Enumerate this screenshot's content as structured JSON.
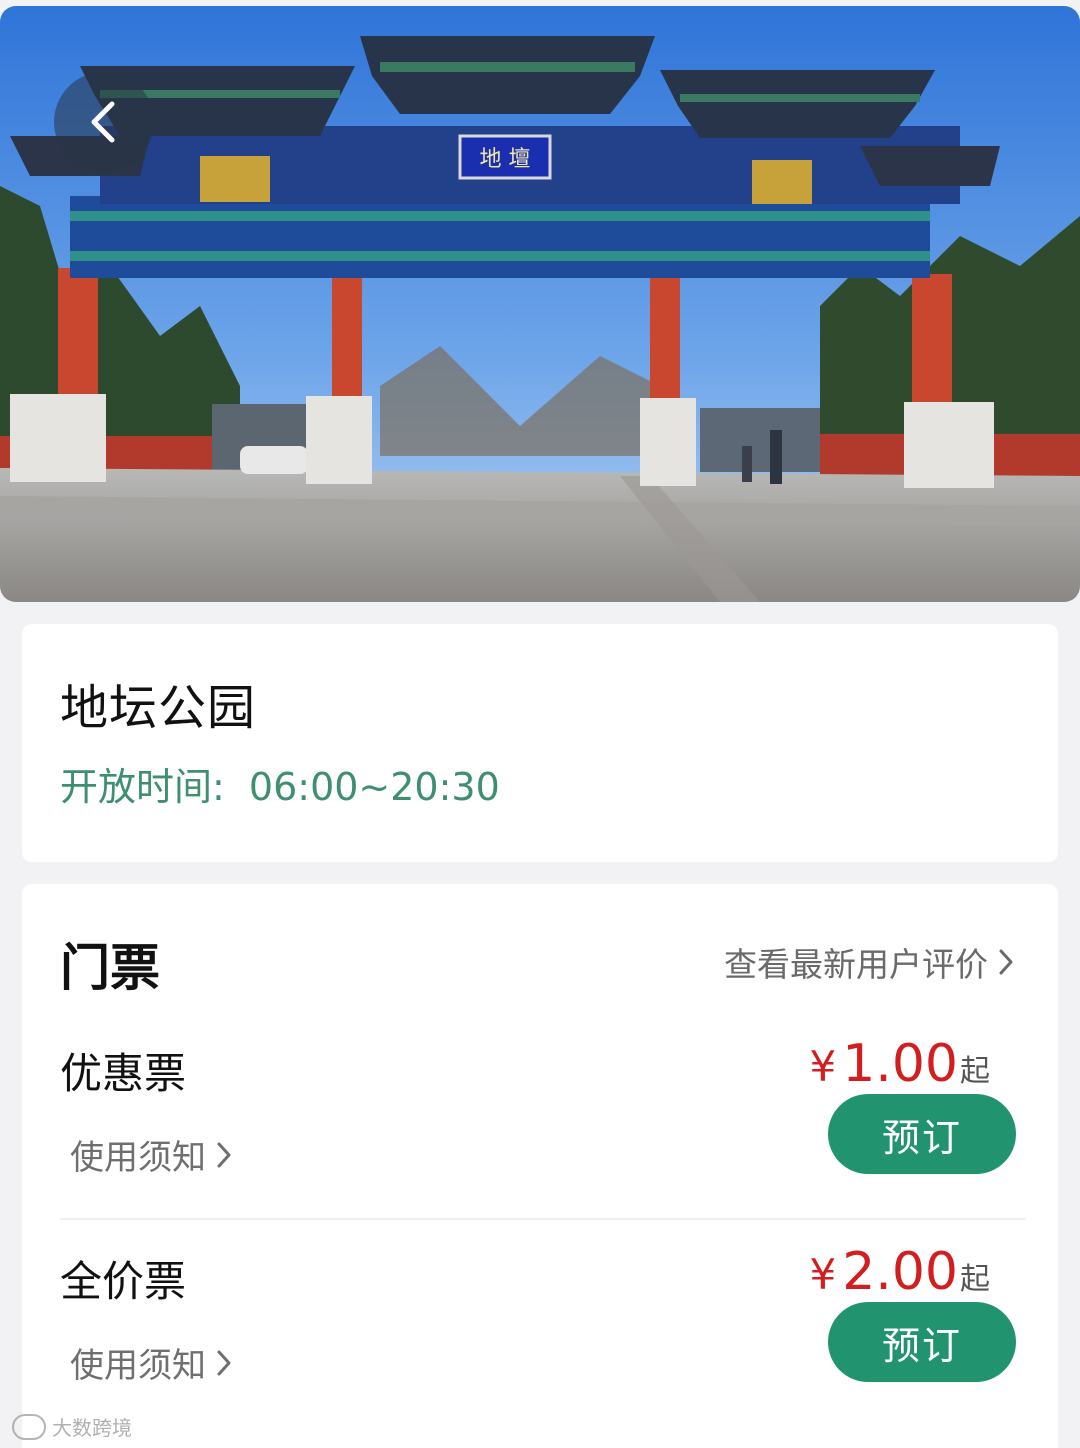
{
  "hero": {
    "back_icon": "chevron-left-icon",
    "signboard_text": "地 壇"
  },
  "park": {
    "name": "地坛公园",
    "hours_label": "开放时间:",
    "hours_value": "06:00~20:30"
  },
  "tickets_section": {
    "title": "门票",
    "reviews_link": "查看最新用户评价",
    "reviews_icon": "chevron-right-icon",
    "items": [
      {
        "name": "优惠票",
        "notice": "使用须知",
        "currency": "¥",
        "price": "1.00",
        "suffix": "起",
        "button": "预订"
      },
      {
        "name": "全价票",
        "notice": "使用须知",
        "currency": "¥",
        "price": "2.00",
        "suffix": "起",
        "button": "预订"
      }
    ]
  },
  "watermark": "大数跨境",
  "colors": {
    "accent_green": "#21946f",
    "hours_green": "#3d8f6e",
    "price_red": "#d21e1e"
  }
}
